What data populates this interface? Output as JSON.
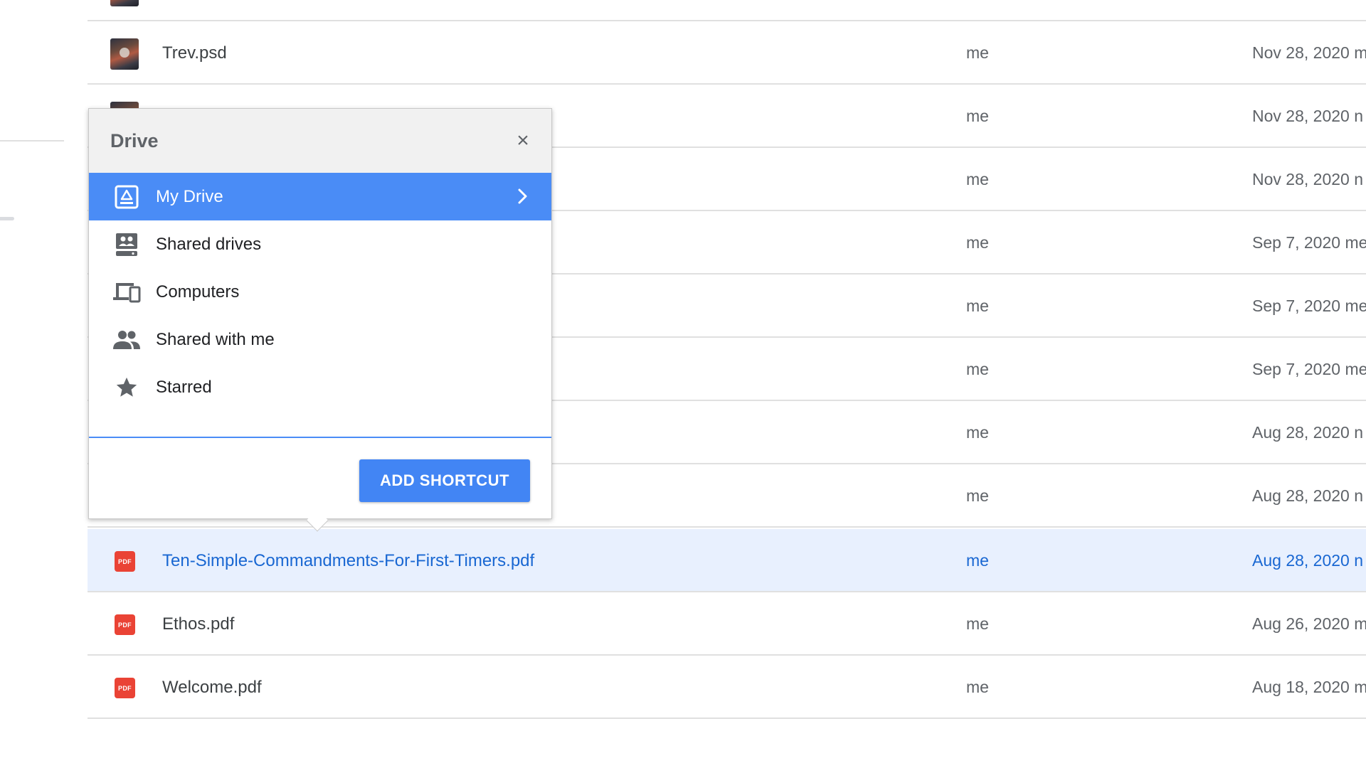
{
  "sidebar": {},
  "files": [
    {
      "name": "",
      "owner": "",
      "modified": "",
      "type": "image"
    },
    {
      "name": "Trev.psd",
      "owner": "me",
      "modified": "Nov 28, 2020 m",
      "type": "image"
    },
    {
      "name": "",
      "owner": "me",
      "modified": "Nov 28, 2020 n",
      "type": "image"
    },
    {
      "name": "",
      "owner": "me",
      "modified": "Nov 28, 2020 n",
      "type": "image"
    },
    {
      "name": "",
      "owner": "me",
      "modified": "Sep 7, 2020 me",
      "type": "image"
    },
    {
      "name": "",
      "owner": "me",
      "modified": "Sep 7, 2020 me",
      "type": "image"
    },
    {
      "name": "",
      "owner": "me",
      "modified": "Sep 7, 2020 me",
      "type": "image"
    },
    {
      "name": "",
      "owner": "me",
      "modified": "Aug 28, 2020 n",
      "type": "image"
    },
    {
      "name": "",
      "owner": "me",
      "modified": "Aug 28, 2020 n",
      "type": "image"
    },
    {
      "name": "Ten-Simple-Commandments-For-First-Timers.pdf",
      "owner": "me",
      "modified": "Aug 28, 2020 n",
      "type": "pdf",
      "selected": true
    },
    {
      "name": "Ethos.pdf",
      "owner": "me",
      "modified": "Aug 26, 2020 m",
      "type": "pdf"
    },
    {
      "name": "Welcome.pdf",
      "owner": "me",
      "modified": "Aug 18, 2020 m",
      "type": "pdf"
    }
  ],
  "pdf_badge": "PDF",
  "popup": {
    "title": "Drive",
    "close_icon": "×",
    "items": [
      {
        "label": "My Drive",
        "icon": "my-drive-icon",
        "active": true
      },
      {
        "label": "Shared drives",
        "icon": "shared-drives-icon"
      },
      {
        "label": "Computers",
        "icon": "computers-icon"
      },
      {
        "label": "Shared with me",
        "icon": "shared-with-me-icon"
      },
      {
        "label": "Starred",
        "icon": "star-icon"
      }
    ],
    "add_button": "ADD SHORTCUT"
  },
  "colors": {
    "accent": "#4a8cf6",
    "button": "#4285f4",
    "selected_row": "#e8f0fe",
    "selected_text": "#1967d2",
    "pdf_red": "#ea4335"
  }
}
